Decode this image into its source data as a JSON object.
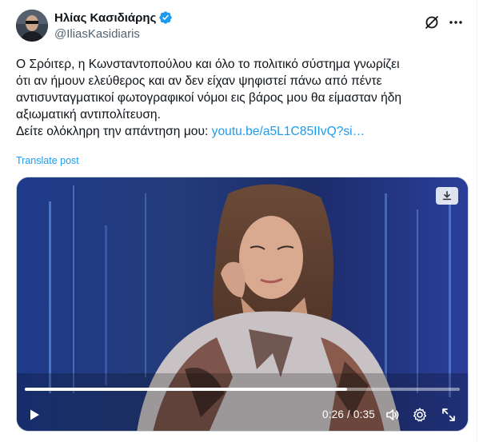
{
  "author": {
    "display_name": "Ηλίας Κασιδιάρης",
    "handle": "@IliasKasidiaris",
    "verified": true
  },
  "tweet": {
    "lines": [
      "Ο Σρόιτερ, η Κωνσταντοπούλου και όλο το πολιτικό σύστημα γνωρίζει",
      "ότι αν ήμουν ελεύθερος και αν δεν είχαν ψηφιστεί πάνω από πέντε",
      "αντισυνταγματικοί φωτογραφικοί νόμοι εις βάρος μου θα είμασταν ήδη",
      "αξιωματική αντιπολίτευση."
    ],
    "last_line_prefix": "Δείτε ολόκληρη την απάντηση μου: ",
    "link_text": "youtu.be/a5L1C85IIvQ?si…",
    "translate_label": "Translate post"
  },
  "video": {
    "current_time": "0:26",
    "duration": "0:35",
    "time_separator": " / ",
    "progress_fraction": 0.74
  },
  "colors": {
    "accent": "#1d9bf0",
    "text": "#0f1419",
    "muted": "#536471",
    "verified_badge": "#1d9bf0"
  },
  "icons": {
    "verified": "verified-badge-icon",
    "grok": "grok-icon",
    "more": "more-options-icon",
    "download": "download-icon",
    "play": "play-icon",
    "volume": "volume-icon",
    "settings": "gear-icon",
    "fullscreen": "fullscreen-icon"
  }
}
